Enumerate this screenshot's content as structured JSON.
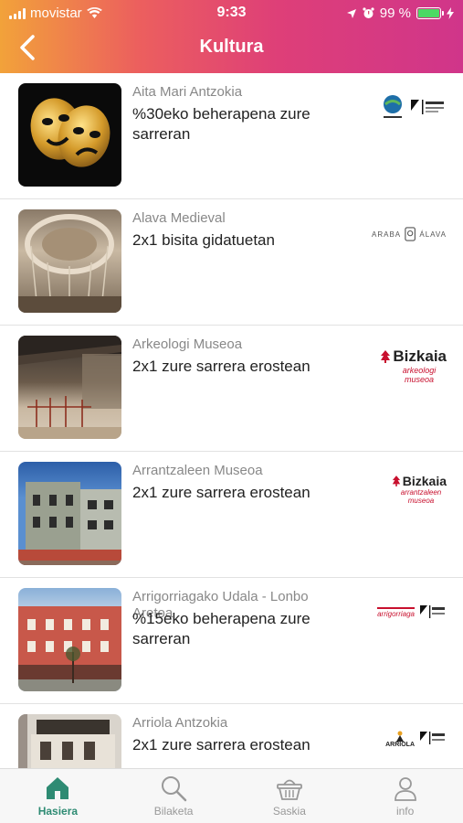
{
  "status_bar": {
    "carrier": "movistar",
    "time": "9:33",
    "battery": "99 %"
  },
  "header": {
    "title": "Kultura",
    "back_icon": "chevron-left-icon"
  },
  "items": [
    {
      "venue": "Aita Mari Antzokia",
      "offer": "%30eko beherapena zure sarreran",
      "image": "theater-masks",
      "logo": "santurtzi-saiba-logo"
    },
    {
      "venue": "Alava Medieval",
      "offer": "2x1 bisita gidatuetan",
      "image": "medieval-dome",
      "logo_text": "ARABA",
      "logo_text2": "ÁLAVA",
      "logo": "araba-alava-logo"
    },
    {
      "venue": "Arkeologi Museoa",
      "offer": "2x1 zure sarrera erostean",
      "image": "museum-interior",
      "logo_text": "Bizkaia",
      "logo_sub": "arkeologi museoa",
      "logo": "bizkaia-arkeologi-logo"
    },
    {
      "venue": "Arrantzaleen Museoa",
      "offer": "2x1 zure sarrera erostean",
      "image": "stone-building",
      "logo_text": "Bizkaia",
      "logo_sub": "arrantzaleen museoa",
      "logo": "bizkaia-arrantzaleen-logo"
    },
    {
      "venue": "Arrigorriagako Udala - Lonbo Aretoa",
      "offer": "%15eko beherapena zure sarreran",
      "image": "red-building",
      "logo_text": "arrigorriaga",
      "logo": "arrigorriaga-saiba-logo"
    },
    {
      "venue": "Arriola Antzokia",
      "offer": "2x1 zure sarrera erostean",
      "image": "arriola-facade",
      "logo_text": "ARRIOLA",
      "logo": "arriola-saiba-logo"
    }
  ],
  "tabbar": [
    {
      "label": "Hasiera",
      "icon": "home-icon",
      "active": true
    },
    {
      "label": "Bilaketa",
      "icon": "search-icon",
      "active": false
    },
    {
      "label": "Saskia",
      "icon": "basket-icon",
      "active": false
    },
    {
      "label": "info",
      "icon": "person-icon",
      "active": false
    }
  ],
  "colors": {
    "header_start": "#f2a23a",
    "header_end": "#d0358a",
    "active_tab": "#2e8b73",
    "bizkaia_red": "#c8102e"
  }
}
